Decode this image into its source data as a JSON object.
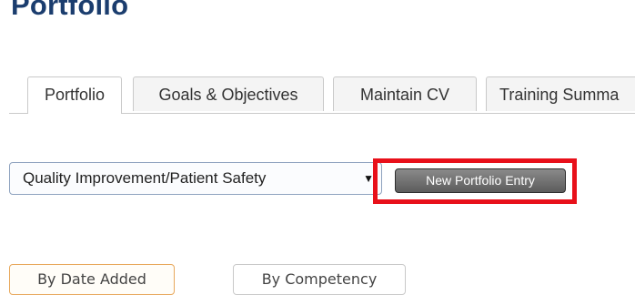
{
  "page": {
    "title": "Portfolio"
  },
  "tabs": [
    {
      "label": "Portfolio",
      "active": true
    },
    {
      "label": "Goals & Objectives",
      "active": false
    },
    {
      "label": "Maintain CV",
      "active": false
    },
    {
      "label": "Training Summa",
      "active": false
    }
  ],
  "filter": {
    "selected": "Quality Improvement/Patient Safety",
    "arrow_icon": "dropdown-triangle-icon"
  },
  "actions": {
    "new_entry_label": "New Portfolio Entry"
  },
  "sort": [
    {
      "label": "By Date Added",
      "active": true
    },
    {
      "label": "By Competency",
      "active": false
    }
  ],
  "colors": {
    "highlight": "#e8101a",
    "title": "#1b3d6e",
    "button_bg": "#6e6e6e"
  }
}
